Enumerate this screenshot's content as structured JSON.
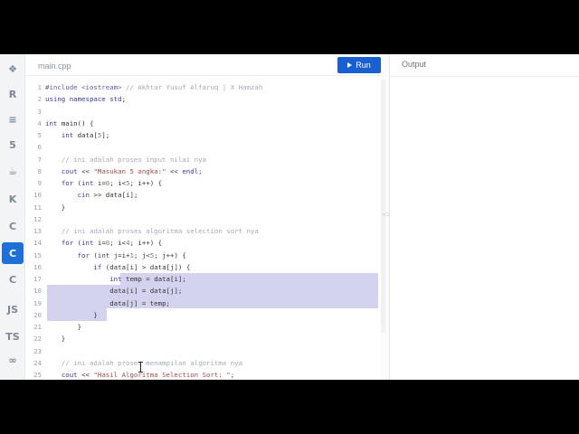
{
  "editor": {
    "file_tab": "main.cpp",
    "run_label": "Run"
  },
  "output": {
    "title": "Output"
  },
  "rail": {
    "items": [
      {
        "name": "python-icon",
        "label": "❖",
        "active": false
      },
      {
        "name": "r-icon",
        "label": "R",
        "active": false
      },
      {
        "name": "database-icon",
        "label": "≡",
        "active": false
      },
      {
        "name": "html5-icon",
        "label": "5",
        "active": false
      },
      {
        "name": "java-icon",
        "label": "☕",
        "active": false
      },
      {
        "name": "kotlin-icon",
        "label": "K",
        "active": false
      },
      {
        "name": "c-icon",
        "label": "C",
        "active": false
      },
      {
        "name": "cpp-icon",
        "label": "C",
        "active": true
      },
      {
        "name": "csharp-icon",
        "label": "C",
        "active": false
      },
      {
        "name": "javascript-icon",
        "label": "JS",
        "active": false
      },
      {
        "name": "typescript-icon",
        "label": "TS",
        "active": false
      },
      {
        "name": "go-icon",
        "label": "∞",
        "active": false
      }
    ]
  },
  "code": {
    "lines": [
      {
        "n": "1",
        "t": "#include <iostream> // Akhtar Yusuf Alfaruq | X Hamzah"
      },
      {
        "n": "2",
        "t": "using namespace std;"
      },
      {
        "n": "3",
        "t": ""
      },
      {
        "n": "4",
        "t": "int main() {"
      },
      {
        "n": "5",
        "t": "    int data[5];"
      },
      {
        "n": "6",
        "t": ""
      },
      {
        "n": "7",
        "t": "    // ini adalah proses input nilai nya"
      },
      {
        "n": "8",
        "t": "    cout << \"Masukan 5 angka:\" << endl;"
      },
      {
        "n": "9",
        "t": "    for (int i=0; i<5; i++) {"
      },
      {
        "n": "10",
        "t": "        cin >> data[i];"
      },
      {
        "n": "11",
        "t": "    }"
      },
      {
        "n": "12",
        "t": ""
      },
      {
        "n": "13",
        "t": "    // ini adalah proses algoritma selection sort nya"
      },
      {
        "n": "14",
        "t": "    for (int i=0; i<4; i++) {"
      },
      {
        "n": "15",
        "t": "        for (int j=i+1; j<5; j++) {"
      },
      {
        "n": "16",
        "t": "            if (data[i] > data[j]) {"
      },
      {
        "n": "17",
        "t": "                int temp = data[i];"
      },
      {
        "n": "18",
        "t": "                data[i] = data[j];"
      },
      {
        "n": "19",
        "t": "                data[j] = temp;"
      },
      {
        "n": "20",
        "t": "            }"
      },
      {
        "n": "21",
        "t": "        }"
      },
      {
        "n": "22",
        "t": "    }"
      },
      {
        "n": "23",
        "t": ""
      },
      {
        "n": "24",
        "t": "    // ini adalah proses menampilan algoritma nya"
      },
      {
        "n": "25",
        "t": "    cout << \"Hasil Algoritma Selection Sort: \";"
      }
    ]
  },
  "colors": {
    "accent": "#1a5fd1",
    "selection": "#d4d3ef"
  }
}
